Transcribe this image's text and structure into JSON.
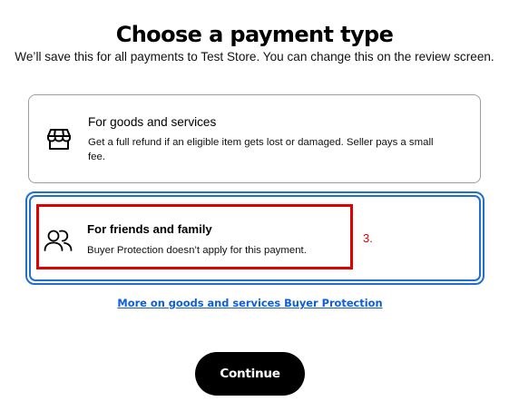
{
  "header": {
    "title": "Choose a payment type",
    "subtitle": "We’ll save this for all payments to Test Store. You can change this on the review screen."
  },
  "options": [
    {
      "title": "For goods and services",
      "description": "Get a full refund if an eligible item gets lost or damaged. Seller pays a small fee.",
      "icon": "storefront-icon",
      "selected": false
    },
    {
      "title": "For friends and family",
      "description": "Buyer Protection doesn’t apply for this payment.",
      "icon": "people-icon",
      "selected": true
    }
  ],
  "annotation": {
    "step_label": "3.",
    "color": "#e00000"
  },
  "link": {
    "label": "More on goods and services Buyer Protection"
  },
  "footer": {
    "continue_label": "Continue"
  },
  "colors": {
    "selected_border": "#1f6fd1",
    "link": "#0f5ed8",
    "button_bg": "#000000",
    "button_text": "#ffffff"
  }
}
